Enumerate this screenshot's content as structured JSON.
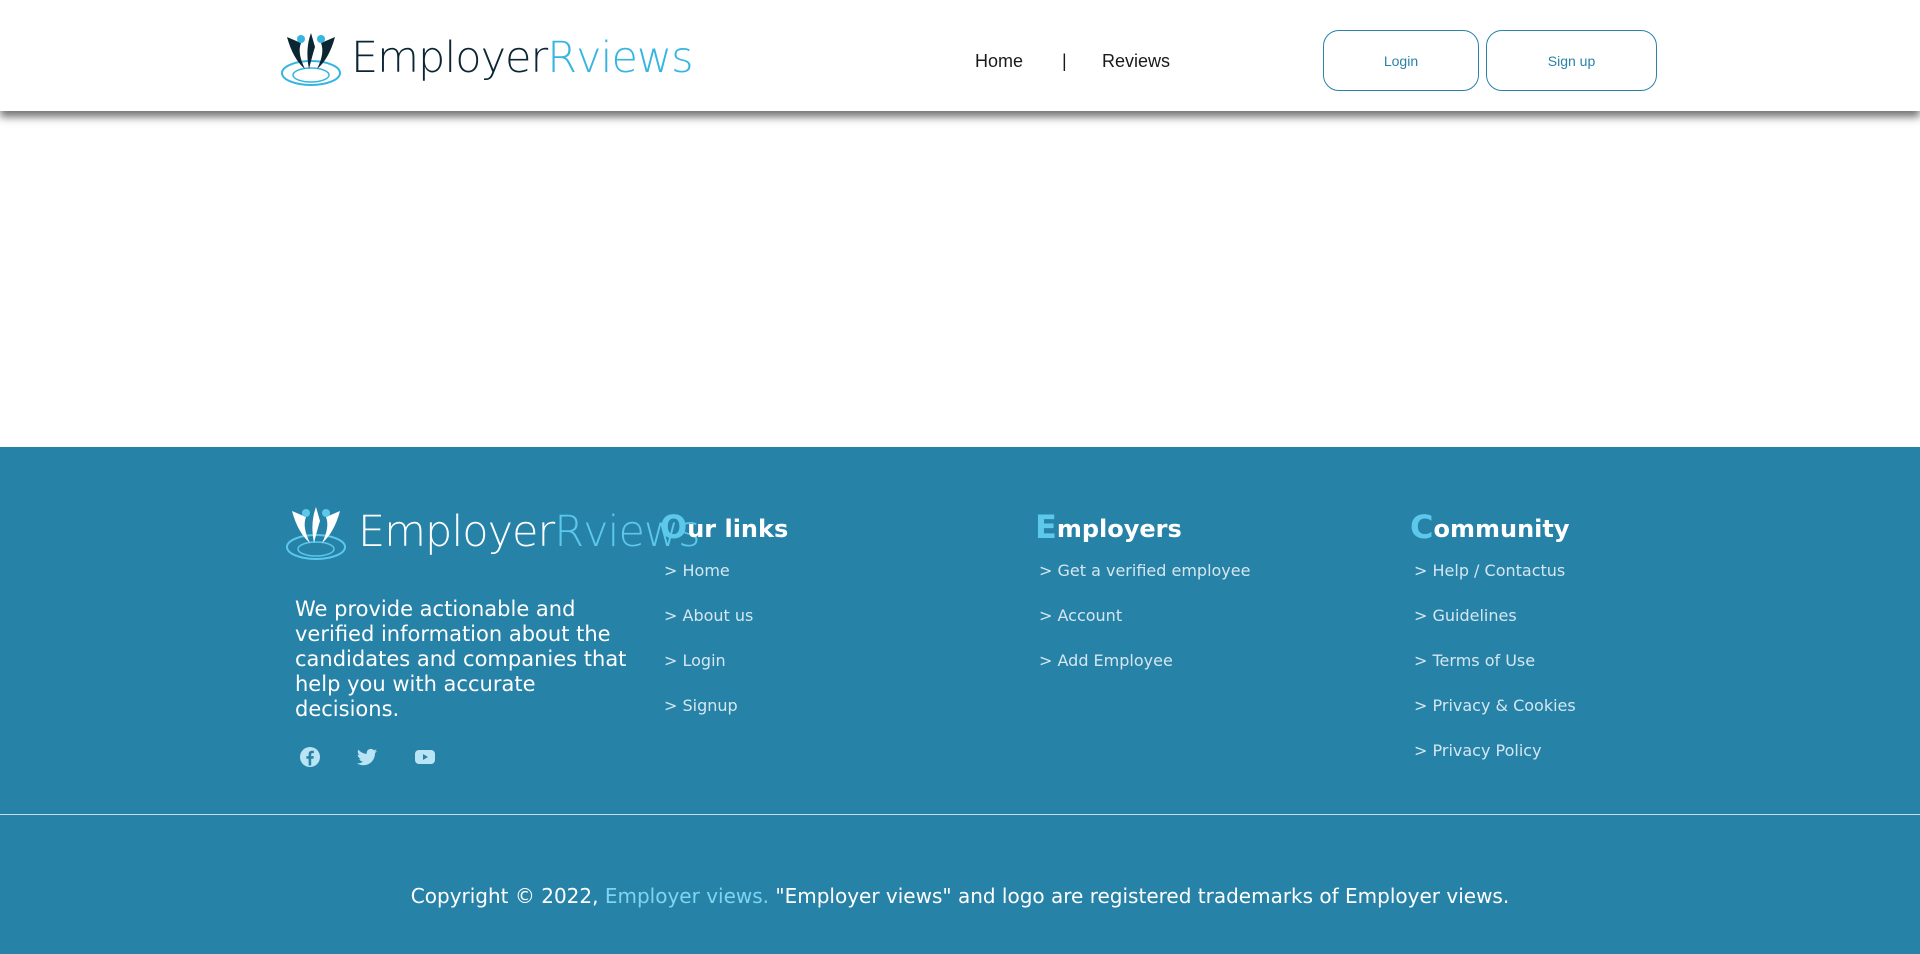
{
  "header": {
    "logo_text_part1": "Employer",
    "logo_text_part2": "Rviews",
    "nav": {
      "home": "Home",
      "separator": "|",
      "reviews": "Reviews"
    },
    "login_label": "Login",
    "signup_label": "Sign up"
  },
  "footer": {
    "logo_text_part1": "Employer",
    "logo_text_part2": "Rviews",
    "about_text": "We provide actionable and verified information about the candidates and companies that help you with accurate decisions.",
    "social": [
      "facebook-icon",
      "twitter-icon",
      "youtube-icon"
    ],
    "columns": {
      "our_links": {
        "title_first": "O",
        "title_rest": "ur links",
        "items": [
          "> Home",
          "> About us",
          "> Login",
          "> Signup"
        ]
      },
      "employers": {
        "title_first": "E",
        "title_rest": "mployers",
        "items": [
          "> Get a verified employee",
          "> Account",
          "> Add Employee"
        ]
      },
      "community": {
        "title_first": "C",
        "title_rest": "ommunity",
        "items": [
          "> Help / Contactus",
          "> Guidelines",
          "> Terms of Use",
          "> Privacy & Cookies",
          "> Privacy Policy"
        ]
      }
    },
    "copyright": {
      "prefix": "Copyright © 2022, ",
      "brand": "Employer views.",
      "suffix": " \"Employer views\" and logo are registered trademarks of Employer views."
    }
  },
  "colors": {
    "accent": "#35b5e0",
    "footer_bg": "#2782a8",
    "button_border": "#2a82a8",
    "dark_text": "#0b2533"
  }
}
